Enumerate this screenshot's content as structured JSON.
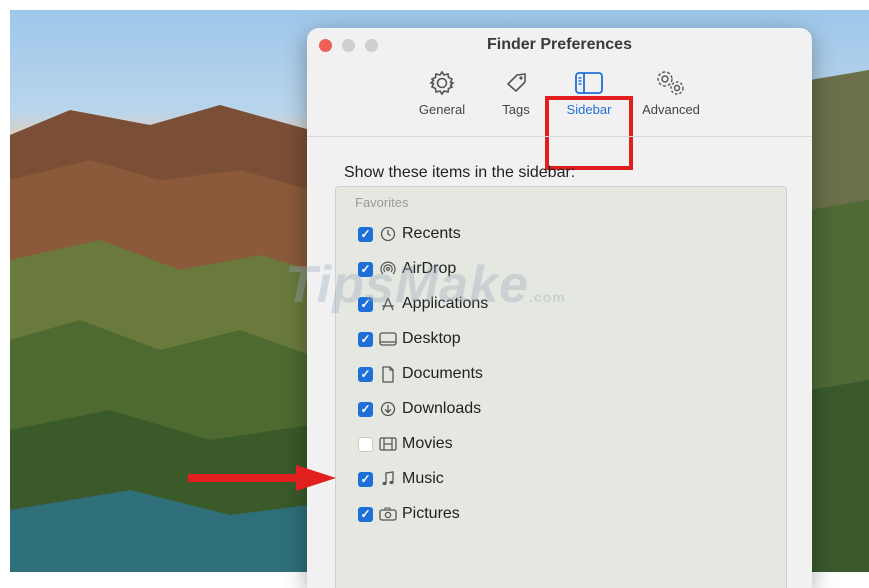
{
  "window": {
    "title": "Finder Preferences"
  },
  "toolbar": {
    "tabs": [
      {
        "label": "General",
        "icon": "gear-icon"
      },
      {
        "label": "Tags",
        "icon": "tag-icon"
      },
      {
        "label": "Sidebar",
        "icon": "sidebar-icon",
        "active": true
      },
      {
        "label": "Advanced",
        "icon": "gears-icon"
      }
    ]
  },
  "sidebar_prefs": {
    "heading": "Show these items in the sidebar:",
    "section": "Favorites",
    "items": [
      {
        "label": "Recents",
        "icon": "clock-icon",
        "checked": true
      },
      {
        "label": "AirDrop",
        "icon": "airdrop-icon",
        "checked": true
      },
      {
        "label": "Applications",
        "icon": "applications-icon",
        "checked": true
      },
      {
        "label": "Desktop",
        "icon": "desktop-icon",
        "checked": true
      },
      {
        "label": "Documents",
        "icon": "document-icon",
        "checked": true
      },
      {
        "label": "Downloads",
        "icon": "download-icon",
        "checked": true
      },
      {
        "label": "Movies",
        "icon": "film-icon",
        "checked": false
      },
      {
        "label": "Music",
        "icon": "music-note-icon",
        "checked": true
      },
      {
        "label": "Pictures",
        "icon": "camera-icon",
        "checked": true
      }
    ]
  },
  "watermark": {
    "text": "TipsMake",
    "suffix": ".com"
  },
  "colors": {
    "accent": "#1f6fd9",
    "highlight": "#e21f1f",
    "arrow": "#e21f1f"
  }
}
